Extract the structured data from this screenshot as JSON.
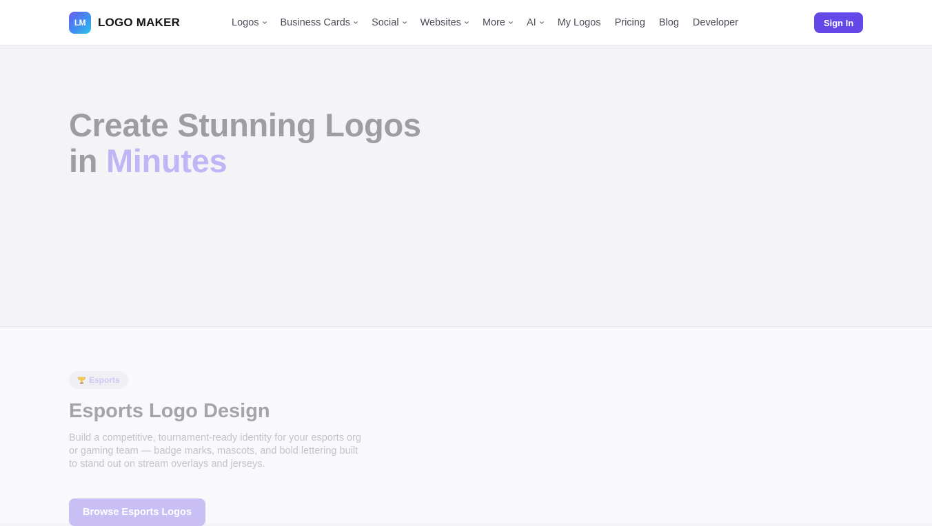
{
  "header": {
    "logo_badge": "LM",
    "logo_text": "LOGO MAKER",
    "nav": [
      {
        "label": "Logos",
        "dropdown": true
      },
      {
        "label": "Business Cards",
        "dropdown": true
      },
      {
        "label": "Social",
        "dropdown": true
      },
      {
        "label": "Websites",
        "dropdown": true
      },
      {
        "label": "More",
        "dropdown": true
      },
      {
        "label": "AI",
        "dropdown": true
      },
      {
        "label": "My Logos",
        "dropdown": false
      },
      {
        "label": "Pricing",
        "dropdown": false
      },
      {
        "label": "Blog",
        "dropdown": false
      },
      {
        "label": "Developer",
        "dropdown": false
      }
    ],
    "signin_label": "Sign In"
  },
  "hero": {
    "title_line1": "Create Stunning Logos",
    "title_line2_prefix": "in ",
    "title_line2_accent": "Minutes"
  },
  "esports": {
    "tag_icon": "trophy-icon",
    "tag_label": "Esports",
    "title": "Esports Logo Design",
    "description": "Build a competitive, tournament-ready identity for your esports org or gaming team — badge marks, mascots, and bold lettering built to stand out on stream overlays and jerseys.",
    "button_label": "Browse Esports Logos"
  },
  "colors": {
    "brand": "#6448e8",
    "accent_faded": "#c0b5f5"
  }
}
